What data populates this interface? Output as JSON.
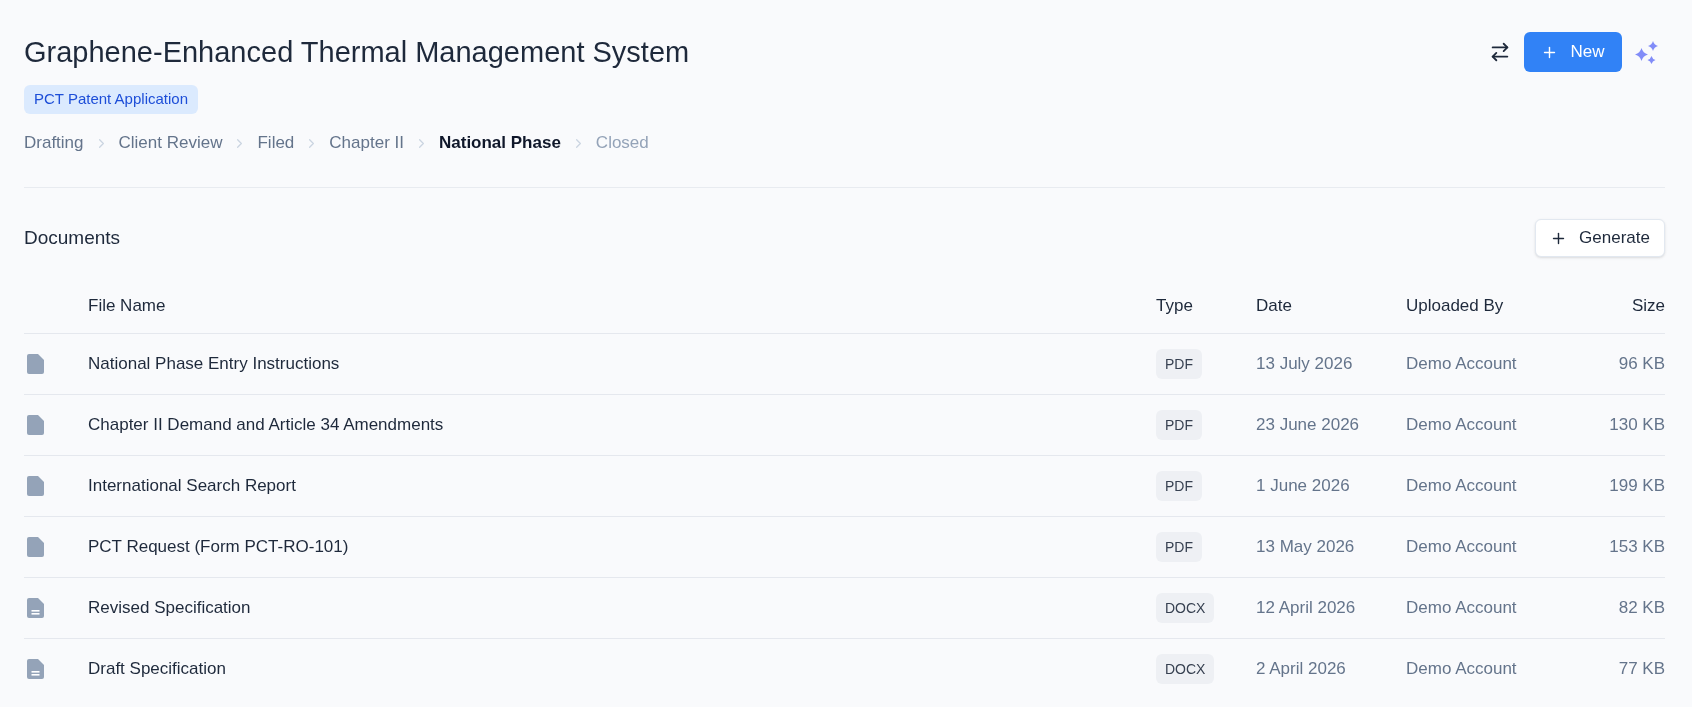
{
  "header": {
    "title": "Graphene-Enhanced Thermal Management System",
    "badge": "PCT Patent Application",
    "new_button": "New"
  },
  "stages": [
    {
      "label": "Drafting",
      "completed": true,
      "selected": false
    },
    {
      "label": "Client Review",
      "completed": true,
      "selected": false
    },
    {
      "label": "Filed",
      "completed": true,
      "selected": false
    },
    {
      "label": "Chapter II",
      "completed": true,
      "selected": false
    },
    {
      "label": "National Phase",
      "completed": false,
      "selected": true
    },
    {
      "label": "Closed",
      "completed": false,
      "selected": false
    }
  ],
  "documents": {
    "title": "Documents",
    "generate_button": "Generate",
    "columns": [
      "File Name",
      "Type",
      "Date",
      "Uploaded By",
      "Size"
    ],
    "rows": [
      {
        "kind": "pdf",
        "name": "National Phase Entry Instructions",
        "type": "PDF",
        "date": "13 July 2026",
        "uploaded_by": "Demo Account",
        "size": "96 KB"
      },
      {
        "kind": "pdf",
        "name": "Chapter II Demand and Article 34 Amendments",
        "type": "PDF",
        "date": "23 June 2026",
        "uploaded_by": "Demo Account",
        "size": "130 KB"
      },
      {
        "kind": "pdf",
        "name": "International Search Report",
        "type": "PDF",
        "date": "1 June 2026",
        "uploaded_by": "Demo Account",
        "size": "199 KB"
      },
      {
        "kind": "pdf",
        "name": "PCT Request (Form PCT-RO-101)",
        "type": "PDF",
        "date": "13 May 2026",
        "uploaded_by": "Demo Account",
        "size": "153 KB"
      },
      {
        "kind": "docx",
        "name": "Revised Specification",
        "type": "DOCX",
        "date": "12 April 2026",
        "uploaded_by": "Demo Account",
        "size": "82 KB"
      },
      {
        "kind": "docx",
        "name": "Draft Specification",
        "type": "DOCX",
        "date": "2 April 2026",
        "uploaded_by": "Demo Account",
        "size": "77 KB"
      }
    ]
  }
}
